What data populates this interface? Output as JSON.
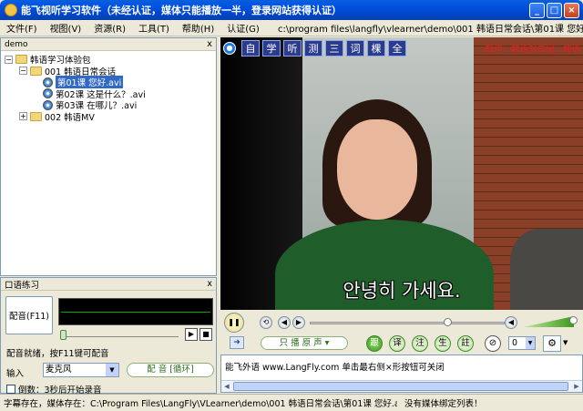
{
  "window": {
    "title": "能飞视听学习软件（未经认证，媒体只能播放一半，登录网站获得认证）"
  },
  "menu": {
    "items": [
      "文件(F)",
      "视图(V)",
      "资源(R)",
      "工具(T)",
      "帮助(H)",
      "认证(G)"
    ],
    "path": "c:\\program files\\langfly\\vlearner\\demo\\001 韩语日常会话\\第01课 您好"
  },
  "tree_panel": {
    "header": "demo",
    "close": "x",
    "root": "韩语学习体验包",
    "folder1": "001 韩语日常会话",
    "lessons": [
      "第01课 您好.avi",
      "第02课 这是什么？.avi",
      "第03课 在哪儿？.avi"
    ],
    "folder2": "002 韩语MV"
  },
  "speak_panel": {
    "header": "口语练习",
    "close": "x",
    "dub_button": "配音(F11)",
    "status": "配音就绪，按F11键可配音",
    "input_label": "输入",
    "input_value": "麦克风",
    "mode_button": "配 音 [循环]",
    "countdown_label": "倒数：3秒后开始录音",
    "countdown_checked": false
  },
  "video": {
    "mode_tabs": [
      "自",
      "学",
      "听",
      "测",
      "三",
      "词",
      "棵",
      "全"
    ],
    "credit": "制作：韩语对白网：韩语",
    "subtitle": "안녕히 가세요."
  },
  "controls": {
    "progress": 0.72,
    "volume": 1.0,
    "orig_button": "只 播 原 声 ▾",
    "lang_buttons": [
      "跟",
      "译",
      "注",
      "生",
      "註"
    ],
    "num_value": "0",
    "gear_icon": "⚙"
  },
  "info": {
    "message": "能飞外语 www.LangFly.com 单击最右侧×形按钮可关闭"
  },
  "statusbar": {
    "left": "字幕存在，媒体存在：C:\\Program Files\\LangFly\\VLearner\\demo\\001 韩语日常会话\\第01课 您好.avi",
    "right": "没有媒体绑定列表！"
  }
}
